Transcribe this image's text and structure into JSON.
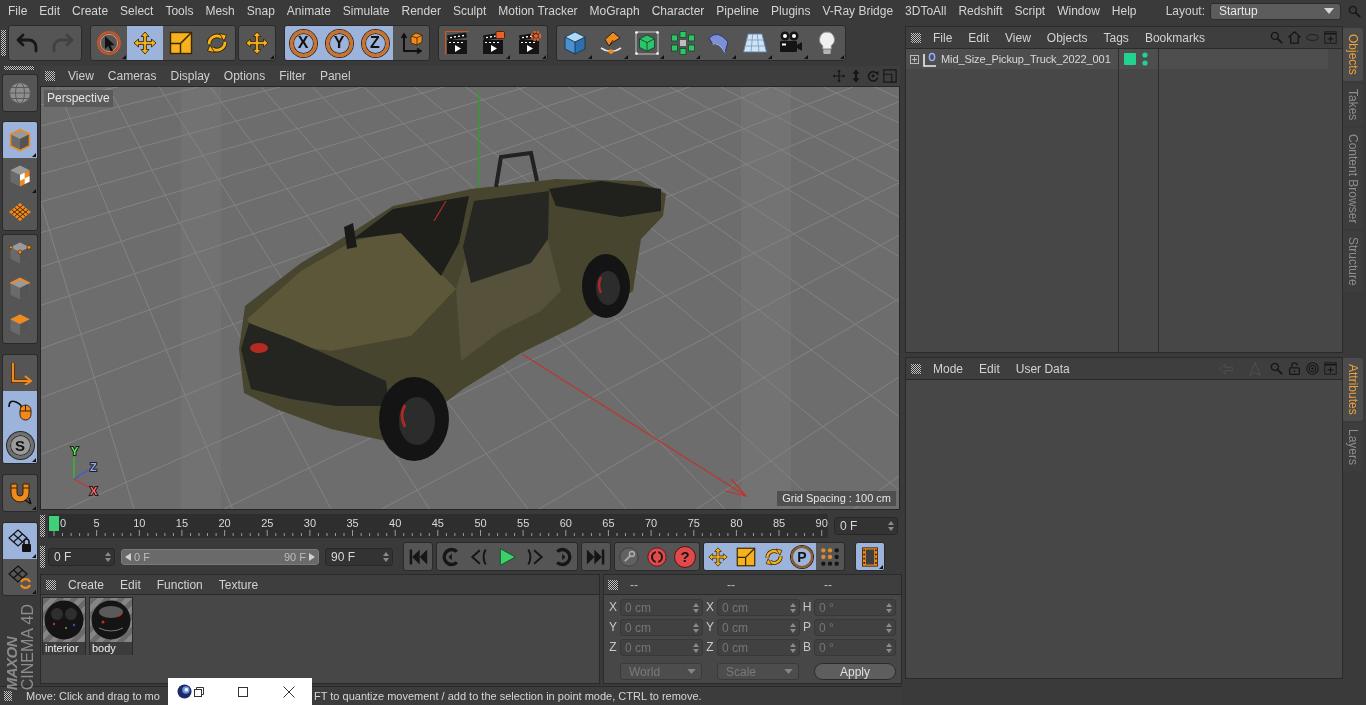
{
  "menu_bar": {
    "items": [
      "File",
      "Edit",
      "Create",
      "Select",
      "Tools",
      "Mesh",
      "Snap",
      "Animate",
      "Simulate",
      "Render",
      "Sculpt",
      "Motion Tracker",
      "MoGraph",
      "Character",
      "Pipeline",
      "Plugins",
      "V-Ray Bridge",
      "3DToAll",
      "Redshift",
      "Script",
      "Window",
      "Help"
    ],
    "layout_label": "Layout:",
    "layout_value": "Startup"
  },
  "toolbar": {
    "history": [
      {
        "disabled": false
      },
      {
        "disabled": true
      }
    ],
    "tools": [
      {
        "selected": false
      },
      {
        "selected": true
      },
      {
        "selected": false
      },
      {
        "selected": false
      }
    ],
    "axis_locks": [
      {
        "label": "X",
        "selected": true
      },
      {
        "label": "Y",
        "selected": true
      },
      {
        "label": "Z",
        "selected": true
      }
    ]
  },
  "mode_toolbar": {
    "groups": [
      [
        {
          "selected": true
        },
        {
          "selected": false
        },
        {
          "selected": false
        }
      ],
      [
        {
          "selected": false
        },
        {
          "selected": false
        },
        {
          "selected": false
        }
      ],
      [
        {
          "selected": false
        },
        {
          "selected": true
        },
        {
          "label": "S",
          "selected": true
        }
      ],
      [
        {
          "selected": false
        }
      ],
      [
        {
          "selected": true
        },
        {
          "selected": false
        }
      ]
    ]
  },
  "logo": {
    "brand": "MAXON",
    "product": "CINEMA 4D"
  },
  "viewport": {
    "menu": [
      "View",
      "Cameras",
      "Display",
      "Options",
      "Filter",
      "Panel"
    ],
    "camera": "Perspective",
    "grid_info": "Grid Spacing : 100 cm",
    "axis_labels": [
      "Y",
      "Z",
      "X"
    ]
  },
  "timeline": {
    "ticks": [
      "0",
      "5",
      "10",
      "15",
      "20",
      "25",
      "30",
      "35",
      "40",
      "45",
      "50",
      "55",
      "60",
      "65",
      "70",
      "75",
      "80",
      "85",
      "90"
    ],
    "level": 0,
    "current_frame": "0 F"
  },
  "playback": {
    "start_field": "0 F",
    "range": {
      "start": "0 F",
      "end": "90 F",
      "level": 1
    },
    "end_field": "90 F",
    "record_buttons": [
      {
        "disabled": true
      },
      {
        "disabled": false
      },
      {
        "label": "?",
        "disabled": false
      }
    ],
    "key_tools": [
      {
        "selected": true
      },
      {
        "selected": true
      },
      {
        "selected": true
      },
      {
        "label": "P",
        "selected": true
      },
      {
        "selected": false
      }
    ],
    "timeline_button": {
      "selected": true
    }
  },
  "materials": {
    "menu": [
      "Create",
      "Edit",
      "Function",
      "Texture"
    ],
    "items": [
      {
        "name": "interior"
      },
      {
        "name": "body"
      }
    ]
  },
  "coordinates": {
    "headers": [
      "--",
      "--",
      "--"
    ],
    "disabled": true,
    "rows": [
      [
        {
          "label": "X",
          "value": "0 cm"
        },
        {
          "label": "X",
          "value": "0 cm"
        },
        {
          "label": "H",
          "value": "0 °"
        }
      ],
      [
        {
          "label": "Y",
          "value": "0 cm"
        },
        {
          "label": "Y",
          "value": "0 cm"
        },
        {
          "label": "P",
          "value": "0 °"
        }
      ],
      [
        {
          "label": "Z",
          "value": "0 cm"
        },
        {
          "label": "Z",
          "value": "0 cm"
        },
        {
          "label": "B",
          "value": "0 °"
        }
      ]
    ],
    "dropdowns": [
      "World",
      "Scale"
    ],
    "apply": "Apply"
  },
  "objects": {
    "menu": [
      "File",
      "Edit",
      "View",
      "Objects",
      "Tags",
      "Bookmarks"
    ],
    "items": [
      {
        "name": "Mid_Size_Pickup_Truck_2022_001",
        "expanded": false
      }
    ]
  },
  "attributes": {
    "menu": [
      "Mode",
      "Edit",
      "User Data"
    ]
  },
  "side_tabs": {
    "upper": [
      {
        "label": "Objects",
        "selected": true
      },
      {
        "label": "Takes",
        "selected": false
      },
      {
        "label": "Content Browser",
        "selected": false
      },
      {
        "label": "Structure",
        "selected": false
      }
    ],
    "lower": [
      {
        "label": "Attributes",
        "selected": true
      },
      {
        "label": "Layers",
        "selected": false
      }
    ]
  },
  "status_bar": {
    "segments": [
      "Move: Click and drag to mo",
      "FT to quantize movement / add to the selection in point mode, CTRL to remove."
    ]
  }
}
